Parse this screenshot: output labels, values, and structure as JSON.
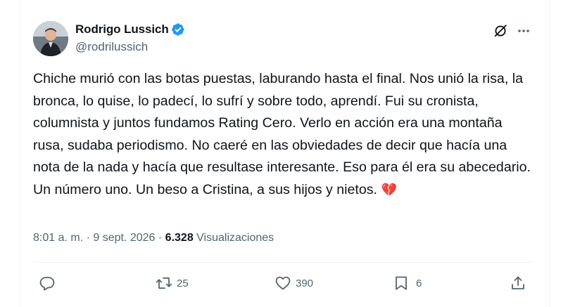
{
  "author": {
    "display_name": "Rodrigo Lussich",
    "handle": "@rodrilussich",
    "verified": true
  },
  "tweet": {
    "text": "Chiche murió con las botas puestas, laburando hasta el final. Nos unió la risa, la bronca, lo quise, lo padecí, lo sufrí y sobre todo, aprendí. Fui su cronista, columnista y juntos fundamos Rating Cero. Verlo en acción era una montaña rusa, sudaba periodismo. No caeré en las obviedades de decir que hacía una nota de la nada y hacía que resultase interesante. Eso para él era su abecedario. Un número uno. Un beso a Cristina, a sus hijos y nietos.",
    "emoji": "💔"
  },
  "meta": {
    "time": "8:01 a. m.",
    "sep": " · ",
    "date": "9 sept. 2026",
    "views_count": "6.328",
    "views_label": "Visualizaciones"
  },
  "actions": {
    "replies": "",
    "reposts": "25",
    "likes": "390",
    "bookmarks": "6"
  },
  "colors": {
    "accent": "#1d9bf0",
    "muted": "#536471",
    "text": "#0f1419",
    "heart_emoji": "#e0245e"
  },
  "icons": [
    "verified-badge-icon",
    "grok-icon",
    "more-icon",
    "reply-icon",
    "repost-icon",
    "like-icon",
    "bookmark-icon",
    "share-icon"
  ]
}
